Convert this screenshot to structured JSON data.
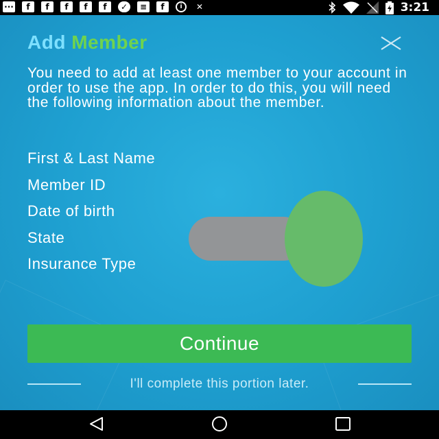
{
  "status_bar": {
    "time": "3:21",
    "left_icons": [
      "message-icon",
      "facebook-icon",
      "facebook-icon",
      "facebook-icon",
      "facebook-icon",
      "facebook-icon",
      "shield-icon",
      "card-icon",
      "facebook-icon",
      "info-icon",
      "signal-tool-icon"
    ],
    "right_icons": [
      "bluetooth-icon",
      "wifi-icon",
      "no-signal-icon",
      "battery-charging-icon"
    ]
  },
  "dialog": {
    "title_word1": "Add",
    "title_word2": "Member",
    "intro": "You need to add at least one member to your account in order to use the app. In order to do this, you will need the following information about the member.",
    "requirements": [
      "First & Last Name",
      "Member ID",
      "Date of birth",
      "State",
      "Insurance Type"
    ],
    "continue_label": "Continue",
    "later_label": "I'll complete this portion later."
  },
  "colors": {
    "background": "#1ea0d2",
    "title_add": "#7ee0ff",
    "title_member": "#6fd34e",
    "button": "#3cba54",
    "toggle_track": "#939597",
    "toggle_knob": "#66bb6a"
  },
  "nav_bar": {
    "buttons": [
      "back-icon",
      "home-icon",
      "recents-icon"
    ]
  }
}
